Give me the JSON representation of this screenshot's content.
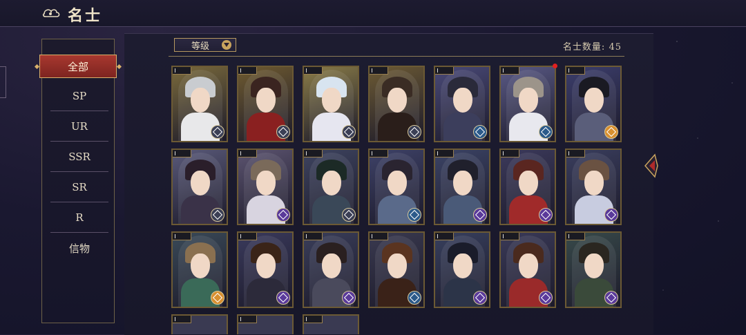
{
  "header": {
    "title": "名士",
    "back_icon": "cloud-back-icon"
  },
  "sidebar": {
    "items": [
      "全部",
      "SP",
      "UR",
      "SSR",
      "SR",
      "R",
      "信物"
    ],
    "active_index": 0
  },
  "toolbar": {
    "sort_label": "等级",
    "count_label": "名士数量:",
    "count_value": "45"
  },
  "cards": [
    {
      "bg": "#7a6a3c",
      "hair": "#c9ccd0",
      "body": "#e8e8ea",
      "emblem": "#3b3f55",
      "level": "1"
    },
    {
      "bg": "#6e5a30",
      "hair": "#3a2420",
      "body": "#8a2020",
      "emblem": "#3b3f55",
      "level": "1"
    },
    {
      "bg": "#8a7c48",
      "hair": "#d8e4f0",
      "body": "#e6e6f0",
      "emblem": "#3b3f55",
      "level": "1"
    },
    {
      "bg": "#6c5a34",
      "hair": "#3a2c24",
      "body": "#2a1e1a",
      "emblem": "#3b3f55",
      "level": "1"
    },
    {
      "bg": "#4a4a78",
      "hair": "#2a2a3a",
      "body": "#3c3e5c",
      "emblem": "#2c5a8a",
      "level": "1"
    },
    {
      "bg": "#5a5a86",
      "hair": "#9c948a",
      "body": "#e8e8ee",
      "emblem": "#2c5a8a",
      "level": "1",
      "dot": true
    },
    {
      "bg": "#3c3e6c",
      "hair": "#1a1a22",
      "body": "#5a5e7a",
      "emblem": "#d89030",
      "level": "1"
    },
    {
      "bg": "#5a5a7a",
      "hair": "#2a1e2a",
      "body": "#3a3248",
      "emblem": "#3b3f55",
      "level": "1"
    },
    {
      "bg": "#5c5470",
      "hair": "#7a6a5a",
      "body": "#d8d4e0",
      "emblem": "#5a3a9a",
      "level": "1"
    },
    {
      "bg": "#3e4460",
      "hair": "#1c2a26",
      "body": "#3a4858",
      "emblem": "#3b3f55",
      "level": "1"
    },
    {
      "bg": "#3e4268",
      "hair": "#2a2430",
      "body": "#5a6a8a",
      "emblem": "#2c5a8a",
      "level": "1"
    },
    {
      "bg": "#3c4466",
      "hair": "#20202c",
      "body": "#4a5a78",
      "emblem": "#5a3a9a",
      "level": "1"
    },
    {
      "bg": "#3c3a5c",
      "hair": "#5a2620",
      "body": "#a02a2a",
      "emblem": "#5a3a9a",
      "level": "1"
    },
    {
      "bg": "#3a3e5e",
      "hair": "#6a5242",
      "body": "#c8cce0",
      "emblem": "#5a3a9a",
      "level": "1"
    },
    {
      "bg": "#3a4a58",
      "hair": "#8a7050",
      "body": "#3a6a58",
      "emblem": "#d89030",
      "level": "1"
    },
    {
      "bg": "#3a3a5c",
      "hair": "#3a2418",
      "body": "#2c2a3a",
      "emblem": "#5a3a9a",
      "level": "1"
    },
    {
      "bg": "#3a3e5a",
      "hair": "#2a2020",
      "body": "#4a4a5c",
      "emblem": "#5a3a9a",
      "level": "1"
    },
    {
      "bg": "#3a3a50",
      "hair": "#5a3420",
      "body": "#3a2218",
      "emblem": "#2c5a8a",
      "level": "1"
    },
    {
      "bg": "#38405e",
      "hair": "#1a1c2a",
      "body": "#2c3448",
      "emblem": "#5a3a9a",
      "level": "1"
    },
    {
      "bg": "#3a3a58",
      "hair": "#4a2a1e",
      "body": "#9a2a2a",
      "emblem": "#5a3a9a",
      "level": "1"
    },
    {
      "bg": "#384a4a",
      "hair": "#2a2620",
      "body": "#3a4a3a",
      "emblem": "#5a3a9a",
      "level": "1"
    }
  ]
}
